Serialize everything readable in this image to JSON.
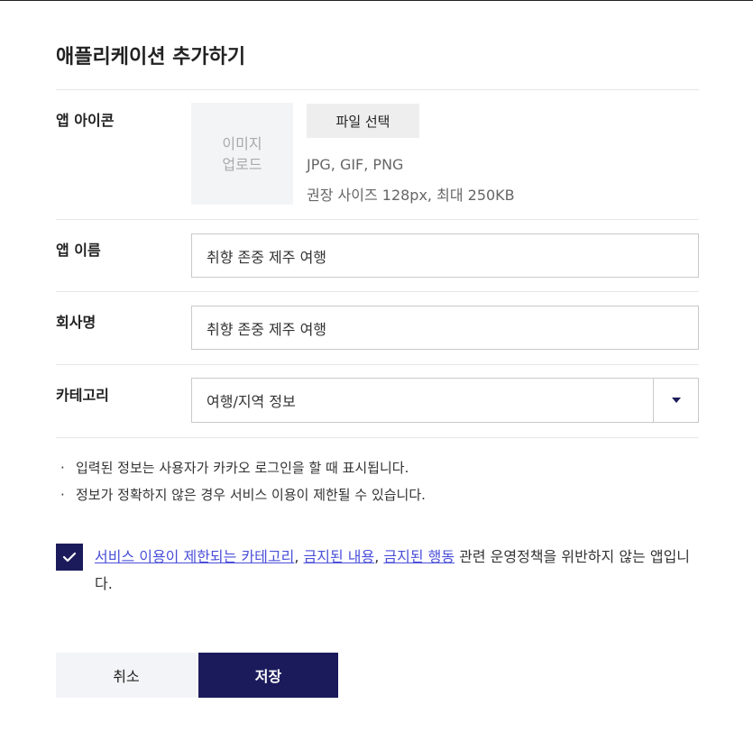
{
  "dialog": {
    "title": "애플리케이션 추가하기"
  },
  "app_icon": {
    "label": "앱 아이콘",
    "upload_line1": "이미지",
    "upload_line2": "업로드",
    "file_button": "파일 선택",
    "formats": "JPG, GIF, PNG",
    "size_hint": "권장 사이즈 128px, 최대 250KB"
  },
  "app_name": {
    "label": "앱 이름",
    "value": "취향 존중 제주 여행"
  },
  "company": {
    "label": "회사명",
    "value": "취향 존중 제주 여행"
  },
  "category": {
    "label": "카테고리",
    "selected": "여행/지역 정보"
  },
  "notes": [
    "입력된 정보는 사용자가 카카오 로그인을 할 때 표시됩니다.",
    "정보가 정확하지 않은 경우 서비스 이용이 제한될 수 있습니다."
  ],
  "agreement": {
    "checked": true,
    "link1": "서비스 이용이 제한되는 카테고리",
    "sep1": ", ",
    "link2": "금지된 내용",
    "sep2": ", ",
    "link3": "금지된 행동",
    "text": " 관련 운영정책을 위반하지 않는 앱입니다."
  },
  "buttons": {
    "cancel": "취소",
    "save": "저장"
  },
  "colors": {
    "primary": "#1b1b5c",
    "link": "#4a4fd8"
  },
  "icons": {
    "dropdown": "chevron-down-icon",
    "checkbox": "checkmark-icon"
  }
}
